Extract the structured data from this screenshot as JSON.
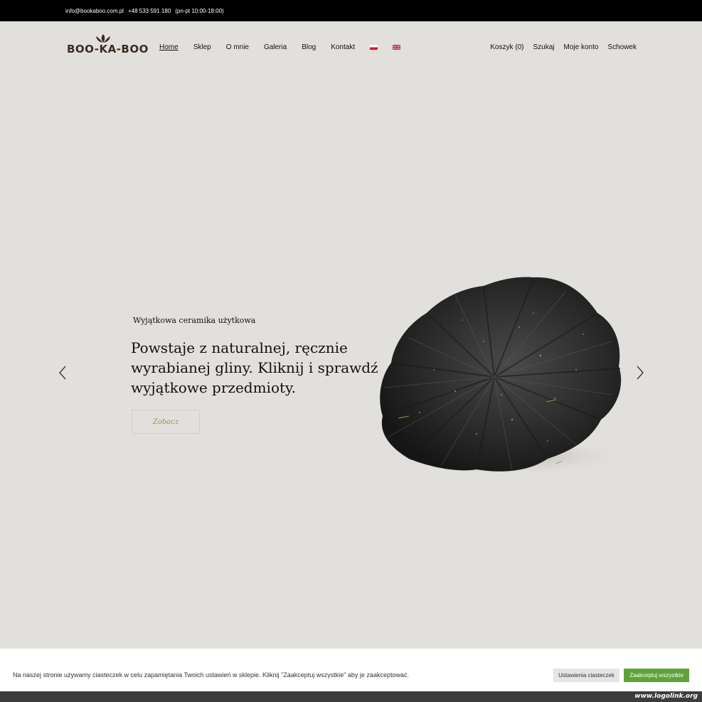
{
  "topbar": {
    "email": "info@bookaboo.com.pl",
    "phone": "+48 533 591 180",
    "hours": "(pn-pt 10:00-18:00)"
  },
  "logo": {
    "text": "BOO-KA-BOO",
    "icon": "lotus-icon"
  },
  "nav": {
    "items": [
      {
        "label": "Home",
        "active": true
      },
      {
        "label": "Sklep"
      },
      {
        "label": "O mnie"
      },
      {
        "label": "Galeria"
      },
      {
        "label": "Blog"
      },
      {
        "label": "Kontakt"
      }
    ],
    "flags": [
      "flag-pl-icon",
      "flag-gb-icon"
    ]
  },
  "right_nav": {
    "cart": "Koszyk (0)",
    "search": "Szukaj",
    "account": "Moje konto",
    "wishlist": "Schowek"
  },
  "hero": {
    "subtitle": "Wyjątkowa ceramika użytkowa",
    "headline": "Powstaje z naturalnej, ręcznie wyrabianej gliny. Kliknij i sprawdź wyjątkowe przedmioty.",
    "cta": "Zobacz",
    "prev_icon": "chevron-left-icon",
    "next_icon": "chevron-right-icon",
    "image": "black-ceramic-plate"
  },
  "cookie": {
    "message": "Na naszej stronie używamy ciasteczek w celu zapamiętania Twoich ustawień w sklepie. Kliknij \"Zaakceptuj wszystkie\" aby je zaakceptować.",
    "settings_label": "Ustawienia ciasteczek",
    "accept_label": "Zaakceptuj wszystkie"
  },
  "watermark": "www.logolink.org",
  "colors": {
    "background": "#e2e0dc",
    "topbar": "#000000",
    "accent_gold": "#a98b55",
    "accept_green": "#5fa23a"
  }
}
